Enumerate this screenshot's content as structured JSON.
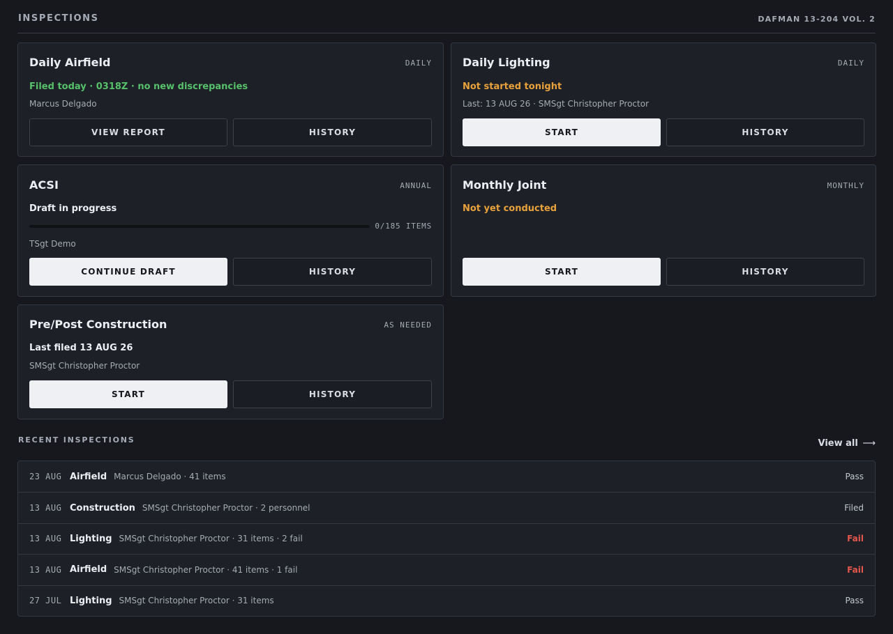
{
  "header": {
    "title": "INSPECTIONS",
    "reference": "DAFMAN 13-204 VOL. 2"
  },
  "cards": {
    "daily_airfield": {
      "title": "Daily Airfield",
      "frequency": "DAILY",
      "status": "Filed today · 0318Z · no new discrepancies",
      "meta": "Marcus Delgado",
      "primary_button": "VIEW REPORT",
      "secondary_button": "HISTORY"
    },
    "daily_lighting": {
      "title": "Daily Lighting",
      "frequency": "DAILY",
      "status": "Not started tonight",
      "meta": "Last: 13 AUG 26 · SMSgt Christopher Proctor",
      "primary_button": "START",
      "secondary_button": "HISTORY"
    },
    "acsi": {
      "title": "ACSI",
      "frequency": "ANNUAL",
      "status": "Draft in progress",
      "progress_label": "0/185 ITEMS",
      "progress_fraction": 0,
      "meta": "TSgt Demo",
      "primary_button": "CONTINUE DRAFT",
      "secondary_button": "HISTORY"
    },
    "monthly_joint": {
      "title": "Monthly Joint",
      "frequency": "MONTHLY",
      "status": "Not yet conducted",
      "primary_button": "START",
      "secondary_button": "HISTORY"
    },
    "construction": {
      "title": "Pre/Post Construction",
      "frequency": "AS NEEDED",
      "status": "Last filed 13 AUG 26",
      "meta": "SMSgt Christopher Proctor",
      "primary_button": "START",
      "secondary_button": "HISTORY"
    }
  },
  "recent": {
    "title": "RECENT INSPECTIONS",
    "view_all": "View all",
    "view_all_arrow": "⟶",
    "rows": [
      {
        "date": "23 AUG",
        "type": "Airfield",
        "desc": "Marcus Delgado · 41 items",
        "result": "Pass",
        "fail": false
      },
      {
        "date": "13 AUG",
        "type": "Construction",
        "desc": "SMSgt Christopher Proctor · 2 personnel",
        "result": "Filed",
        "fail": false
      },
      {
        "date": "13 AUG",
        "type": "Lighting",
        "desc": "SMSgt Christopher Proctor · 31 items · 2 fail",
        "result": "Fail",
        "fail": true
      },
      {
        "date": "13 AUG",
        "type": "Airfield",
        "desc": "SMSgt Christopher Proctor · 41 items · 1 fail",
        "result": "Fail",
        "fail": true
      },
      {
        "date": "27 JUL",
        "type": "Lighting",
        "desc": "SMSgt Christopher Proctor · 31 items",
        "result": "Pass",
        "fail": false
      }
    ]
  },
  "colors": {
    "background": "#16181d",
    "card": "#1d2027",
    "status_green": "#57c06a",
    "status_orange": "#e9a23b",
    "fail_red": "#e5574c"
  }
}
